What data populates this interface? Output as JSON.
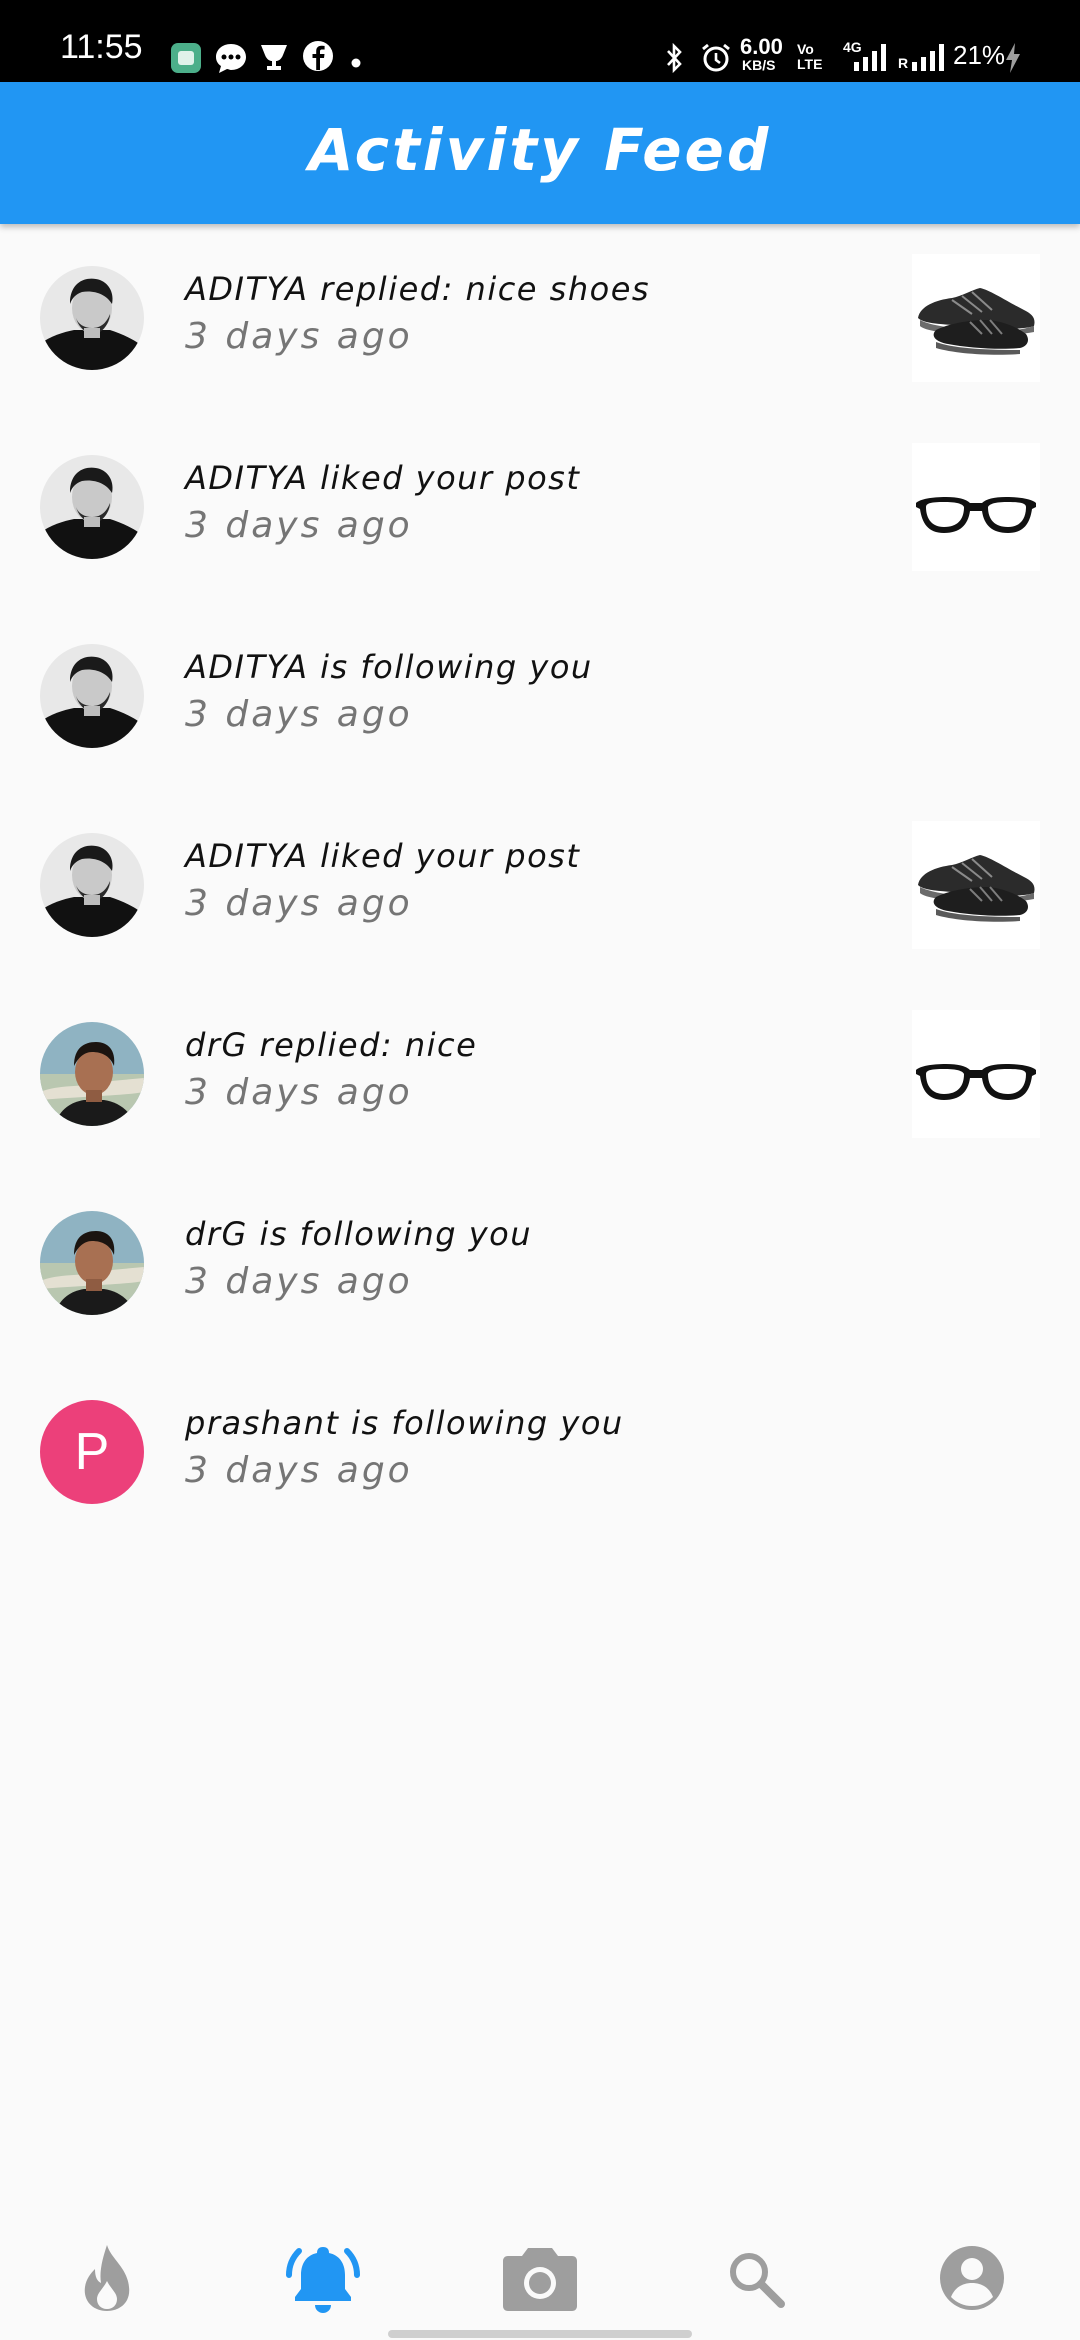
{
  "status_bar": {
    "time": "11:55",
    "speed_value": "6.00",
    "speed_unit": "KB/S",
    "volte": "Vo\nLTE",
    "network": "4G",
    "roaming": "R",
    "battery": "21%",
    "left_icons": [
      "app-icon",
      "chat-icon",
      "trophy-icon",
      "facebook-icon",
      "dot-icon"
    ],
    "right_icons": [
      "bluetooth-icon",
      "alarm-icon",
      "signal-icon",
      "signal-icon",
      "charging-icon"
    ]
  },
  "header": {
    "title": "Activity Feed"
  },
  "feed": [
    {
      "title": "ADITYA replied: nice shoes",
      "time": "3 days ago",
      "avatar": "photo-aditya",
      "thumb": "shoes"
    },
    {
      "title": "ADITYA liked your post",
      "time": "3 days ago",
      "avatar": "photo-aditya",
      "thumb": "glasses"
    },
    {
      "title": "ADITYA is following you",
      "time": "3 days ago",
      "avatar": "photo-aditya",
      "thumb": ""
    },
    {
      "title": "ADITYA liked your post",
      "time": "3 days ago",
      "avatar": "photo-aditya",
      "thumb": "shoes"
    },
    {
      "title": "drG replied: nice",
      "time": "3 days ago",
      "avatar": "photo-drg",
      "thumb": "glasses"
    },
    {
      "title": "drG is following you",
      "time": "3 days ago",
      "avatar": "photo-drg",
      "thumb": ""
    },
    {
      "title": "prashant is following you",
      "time": "3 days ago",
      "avatar_letter": "P",
      "thumb": ""
    }
  ],
  "bottom_nav": {
    "items": [
      {
        "icon": "flame-icon",
        "active": false
      },
      {
        "icon": "bell-icon",
        "active": true
      },
      {
        "icon": "camera-icon",
        "active": false
      },
      {
        "icon": "search-icon",
        "active": false
      },
      {
        "icon": "account-icon",
        "active": false
      }
    ],
    "active_color": "#2196f3",
    "inactive_color": "#9e9e9e"
  },
  "colors": {
    "app_bar": "#2196f3",
    "avatar_letter_bg": "#ec407a",
    "background": "#fafafa"
  }
}
